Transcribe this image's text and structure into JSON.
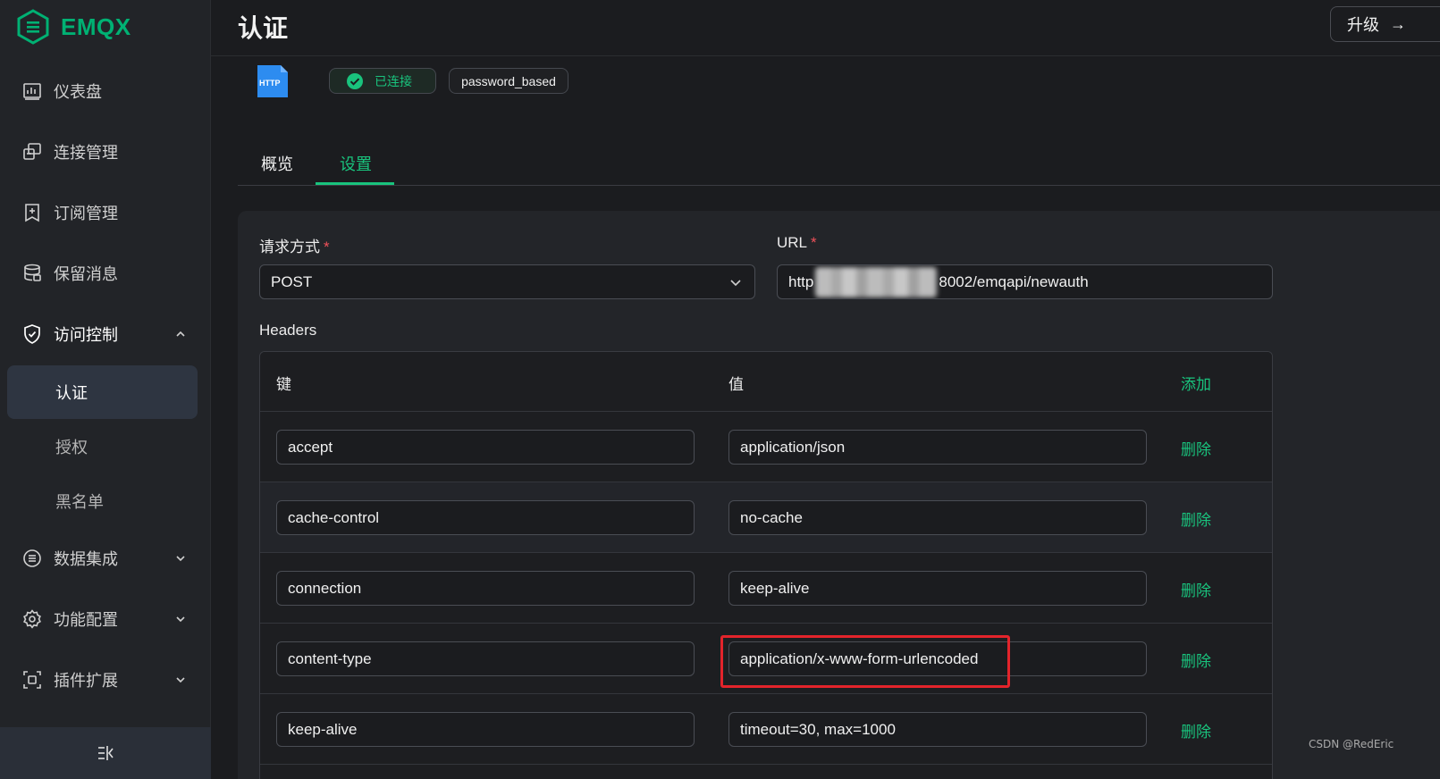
{
  "app": {
    "logo_text": "EMQX",
    "brand_color": "#00b173",
    "accent": "#19c37d"
  },
  "sidebar": {
    "items": [
      {
        "label": "仪表盘",
        "icon": "dashboard-icon"
      },
      {
        "label": "连接管理",
        "icon": "connections-icon"
      },
      {
        "label": "订阅管理",
        "icon": "subscriptions-icon"
      },
      {
        "label": "保留消息",
        "icon": "retained-icon"
      },
      {
        "label": "访问控制",
        "icon": "shield-icon",
        "expanded": true,
        "children": [
          {
            "label": "认证",
            "active": true
          },
          {
            "label": "授权"
          },
          {
            "label": "黑名单"
          }
        ]
      },
      {
        "label": "数据集成",
        "icon": "integration-icon"
      },
      {
        "label": "功能配置",
        "icon": "gear-icon"
      },
      {
        "label": "插件扩展",
        "icon": "plugin-icon"
      }
    ],
    "collapse_icon": "collapse-sidebar-icon"
  },
  "header": {
    "title": "认证",
    "upgrade_label": "升级",
    "upgrade_arrow": "→"
  },
  "auth": {
    "backend_icon_text": "HTTP",
    "status_label": "已连接",
    "mechanism": "password_based"
  },
  "tabs": [
    {
      "label": "概览"
    },
    {
      "label": "设置",
      "active": true
    }
  ],
  "form": {
    "method_label": "请求方式",
    "method_value": "POST",
    "url_label": "URL",
    "url_prefix": "http",
    "url_suffix": "8002/emqapi/newauth",
    "required_mark": "*",
    "headers_label": "Headers",
    "headers_columns": {
      "key": "键",
      "value": "值",
      "add": "添加"
    },
    "headers": [
      {
        "key": "accept",
        "value": "application/json"
      },
      {
        "key": "cache-control",
        "value": "no-cache"
      },
      {
        "key": "connection",
        "value": "keep-alive"
      },
      {
        "key": "content-type",
        "value": "application/x-www-form-urlencoded"
      },
      {
        "key": "keep-alive",
        "value": "timeout=30, max=1000"
      }
    ],
    "delete_label": "删除"
  },
  "watermark": "CSDN @RedEric"
}
